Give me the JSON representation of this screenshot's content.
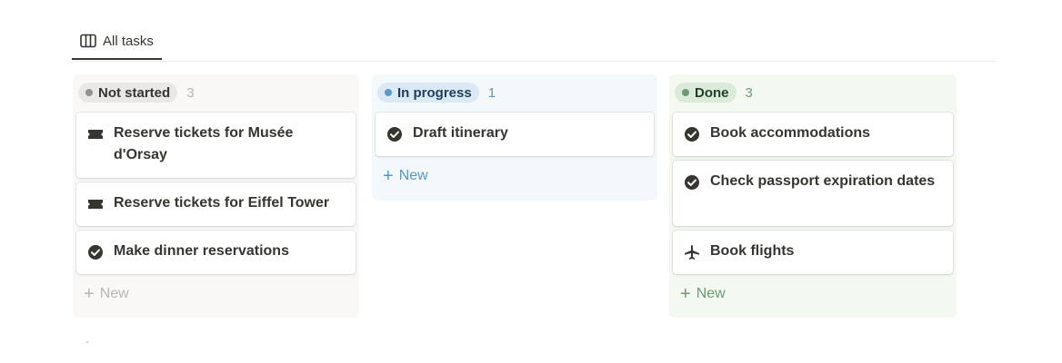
{
  "view_tab": {
    "label": "All tasks",
    "icon": "board-icon"
  },
  "columns": [
    {
      "status": "Not started",
      "count": "3",
      "color": "#91918e",
      "cards": [
        {
          "title": "Reserve tickets for Musée d'Orsay",
          "icon": "ticket-icon"
        },
        {
          "title": "Reserve tickets for Eiffel Tower",
          "icon": "ticket-icon"
        },
        {
          "title": "Make dinner reservations",
          "icon": "check-circle-icon"
        }
      ],
      "new_label": "New"
    },
    {
      "status": "In progress",
      "count": "1",
      "color": "#5a97c8",
      "cards": [
        {
          "title": "Draft itinerary",
          "icon": "check-circle-icon"
        }
      ],
      "new_label": "New"
    },
    {
      "status": "Done",
      "count": "3",
      "color": "#6c9b72",
      "cards": [
        {
          "title": "Book accommodations",
          "icon": "check-circle-icon"
        },
        {
          "title": "Check passport expiration dates",
          "icon": "check-circle-icon"
        },
        {
          "title": "Book flights",
          "icon": "airplane-icon"
        }
      ],
      "new_label": "New"
    }
  ]
}
